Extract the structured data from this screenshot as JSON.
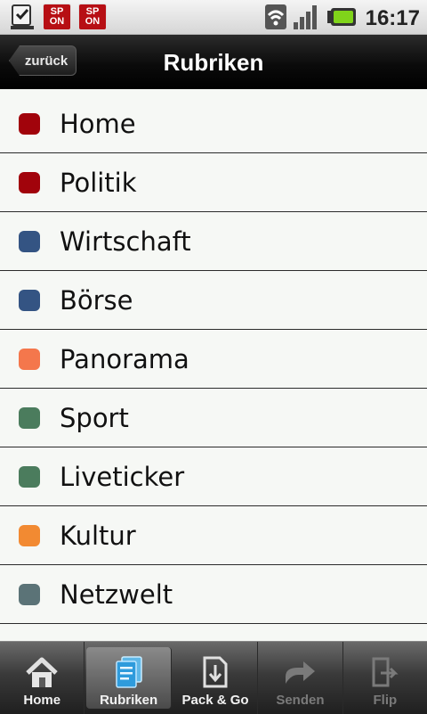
{
  "status": {
    "time": "16:17",
    "spon_icons": [
      {
        "line1": "SP",
        "line2": "ON"
      },
      {
        "line1": "SP",
        "line2": "ON"
      }
    ]
  },
  "header": {
    "back_label": "zurück",
    "title": "Rubriken"
  },
  "sections": [
    {
      "label": "Home",
      "color": "#a1030b"
    },
    {
      "label": "Politik",
      "color": "#a1030b"
    },
    {
      "label": "Wirtschaft",
      "color": "#345483"
    },
    {
      "label": "Börse",
      "color": "#345483"
    },
    {
      "label": "Panorama",
      "color": "#f4774c"
    },
    {
      "label": "Sport",
      "color": "#4b7c5d"
    },
    {
      "label": "Liveticker",
      "color": "#4b7c5d"
    },
    {
      "label": "Kultur",
      "color": "#f28a32"
    },
    {
      "label": "Netzwelt",
      "color": "#5b7377"
    }
  ],
  "tabbar": {
    "tabs": [
      {
        "label": "Home",
        "icon": "home-icon"
      },
      {
        "label": "Rubriken",
        "icon": "rubriken-icon"
      },
      {
        "label": "Pack & Go",
        "icon": "pack-go-icon"
      },
      {
        "label": "Senden",
        "icon": "share-icon"
      },
      {
        "label": "Flip",
        "icon": "flip-icon"
      }
    ],
    "active": "Rubriken"
  }
}
